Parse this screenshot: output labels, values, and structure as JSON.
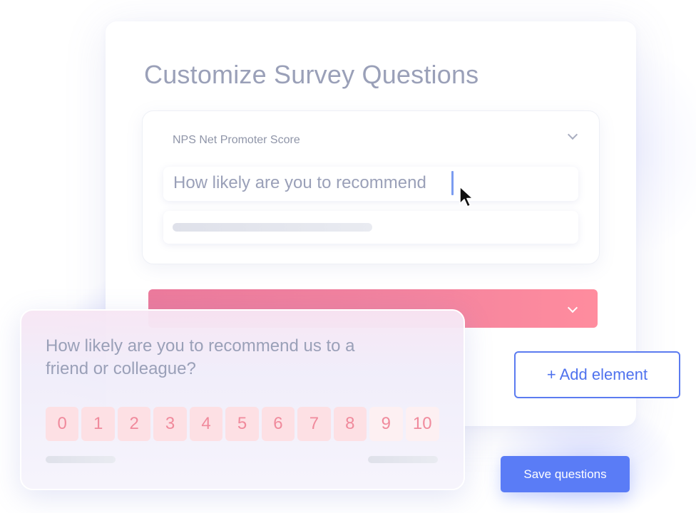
{
  "page": {
    "title": "Customize Survey Questions"
  },
  "question_editor": {
    "type_label": "NPS Net Promoter Score",
    "question_input_value": "How likely are you to recommend"
  },
  "preview": {
    "question": "How likely are you to recommend us to a friend or colleague?",
    "scale": [
      "0",
      "1",
      "2",
      "3",
      "4",
      "5",
      "6",
      "7",
      "8",
      "9",
      "10"
    ]
  },
  "actions": {
    "add_element_label": "+ Add element",
    "save_label": "Save questions"
  },
  "colors": {
    "accent": "#5a7cf6",
    "pink_bar_start": "#ec7a9c",
    "pink_bar_end": "#ff8c9e",
    "scale_number": "#f08a9c",
    "muted_text": "#9aa0b8"
  },
  "icons": {
    "dropdown": "chevron-down-icon",
    "pointer": "mouse-pointer-icon",
    "text_caret": "text-caret-icon"
  }
}
